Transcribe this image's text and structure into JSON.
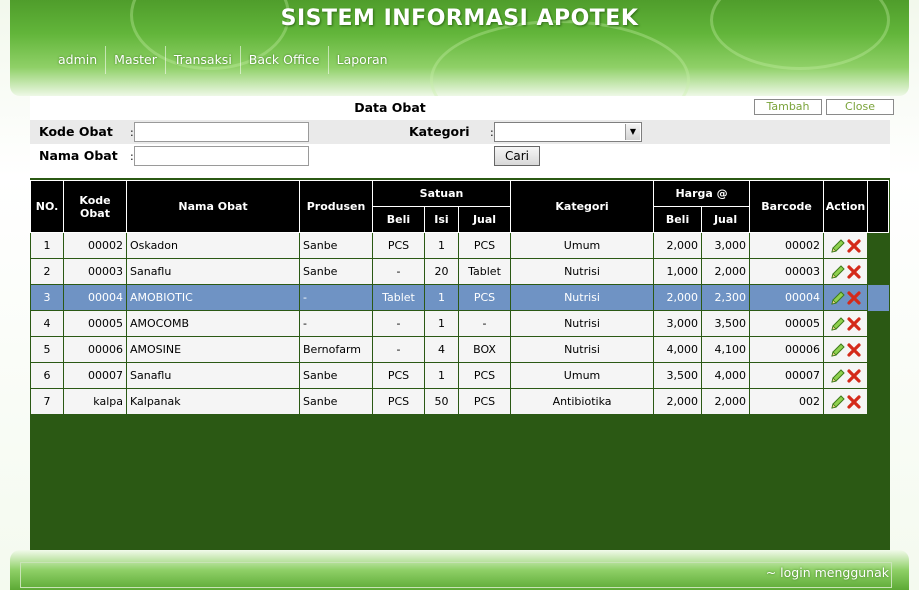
{
  "app": {
    "title": "SISTEM INFORMASI APOTEK"
  },
  "menu": [
    {
      "label": "admin"
    },
    {
      "label": "Master"
    },
    {
      "label": "Transaksi"
    },
    {
      "label": "Back Office"
    },
    {
      "label": "Laporan"
    }
  ],
  "form": {
    "title": "Data Obat",
    "tambah_label": "Tambah",
    "close_label": "Close",
    "kode_obat_label": "Kode Obat",
    "nama_obat_label": "Nama Obat",
    "kategori_label": "Kategori",
    "colon": ":",
    "kode_obat_value": "",
    "nama_obat_value": "",
    "kategori_value": "",
    "cari_label": "Cari"
  },
  "table": {
    "headers": {
      "no": "NO.",
      "kode": "Kode Obat",
      "nama": "Nama Obat",
      "produsen": "Produsen",
      "satuan": "Satuan",
      "beli": "Beli",
      "isi": "Isi",
      "jual": "Jual",
      "kategori": "Kategori",
      "harga": "Harga @",
      "harga_beli": "Beli",
      "harga_jual": "Jual",
      "barcode": "Barcode",
      "action": "Action"
    },
    "rows": [
      {
        "no": "1",
        "kode": "00002",
        "nama": "Oskadon",
        "produsen": "Sanbe",
        "beli": "PCS",
        "isi": "1",
        "jual": "PCS",
        "kategori": "Umum",
        "harga_beli": "2,000",
        "harga_jual": "3,000",
        "barcode": "00002"
      },
      {
        "no": "2",
        "kode": "00003",
        "nama": "Sanaflu",
        "produsen": "Sanbe",
        "beli": "-",
        "isi": "20",
        "jual": "Tablet",
        "kategori": "Nutrisi",
        "harga_beli": "1,000",
        "harga_jual": "2,000",
        "barcode": "00003"
      },
      {
        "no": "3",
        "kode": "00004",
        "nama": "AMOBIOTIC",
        "produsen": "-",
        "beli": "Tablet",
        "isi": "1",
        "jual": "PCS",
        "kategori": "Nutrisi",
        "harga_beli": "2,000",
        "harga_jual": "2,300",
        "barcode": "00004"
      },
      {
        "no": "4",
        "kode": "00005",
        "nama": "AMOCOMB",
        "produsen": "-",
        "beli": "-",
        "isi": "1",
        "jual": "-",
        "kategori": "Nutrisi",
        "harga_beli": "3,000",
        "harga_jual": "3,500",
        "barcode": "00005"
      },
      {
        "no": "5",
        "kode": "00006",
        "nama": "AMOSINE",
        "produsen": "Bernofarm",
        "beli": "-",
        "isi": "4",
        "jual": "BOX",
        "kategori": "Nutrisi",
        "harga_beli": "4,000",
        "harga_jual": "4,100",
        "barcode": "00006"
      },
      {
        "no": "6",
        "kode": "00007",
        "nama": "Sanaflu",
        "produsen": "Sanbe",
        "beli": "PCS",
        "isi": "1",
        "jual": "PCS",
        "kategori": "Umum",
        "harga_beli": "3,500",
        "harga_jual": "4,000",
        "barcode": "00007"
      },
      {
        "no": "7",
        "kode": "kalpa",
        "nama": "Kalpanak",
        "produsen": "Sanbe",
        "beli": "PCS",
        "isi": "50",
        "jual": "PCS",
        "kategori": "Antibiotika",
        "harga_beli": "2,000",
        "harga_jual": "2,000",
        "barcode": "002"
      }
    ],
    "selected_row": 2,
    "icons": {
      "edit": "pencil-icon",
      "delete": "delete-x-icon"
    }
  },
  "footer": {
    "text": "~ login menggunak"
  },
  "colors": {
    "header_green": "#62b53a",
    "content_bg": "#2b5914",
    "selected_row": "#6f93c4",
    "header_cell": "#000000"
  }
}
